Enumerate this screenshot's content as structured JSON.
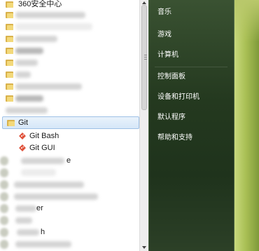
{
  "program_list": {
    "first_visible_label": "360安全中心",
    "git_folder_label": "Git",
    "git_items": [
      {
        "label": "Git Bash"
      },
      {
        "label": "Git GUI"
      }
    ],
    "partial_labels": {
      "row_230": "e",
      "row_298": "er",
      "row_332": "h"
    }
  },
  "right_menu": {
    "items": [
      {
        "label": "音乐"
      },
      {
        "label": "游戏"
      },
      {
        "label": "计算机"
      },
      {
        "label": "控制面板"
      },
      {
        "label": "设备和打印机"
      },
      {
        "label": "默认程序"
      },
      {
        "label": "帮助和支持"
      }
    ]
  },
  "colors": {
    "git_highlight": "#d6e7f8",
    "panel_bg": "#24391f",
    "wallpaper": "#aac055"
  },
  "icons": {
    "folder": "folder-icon",
    "git": "git-logo-icon"
  }
}
